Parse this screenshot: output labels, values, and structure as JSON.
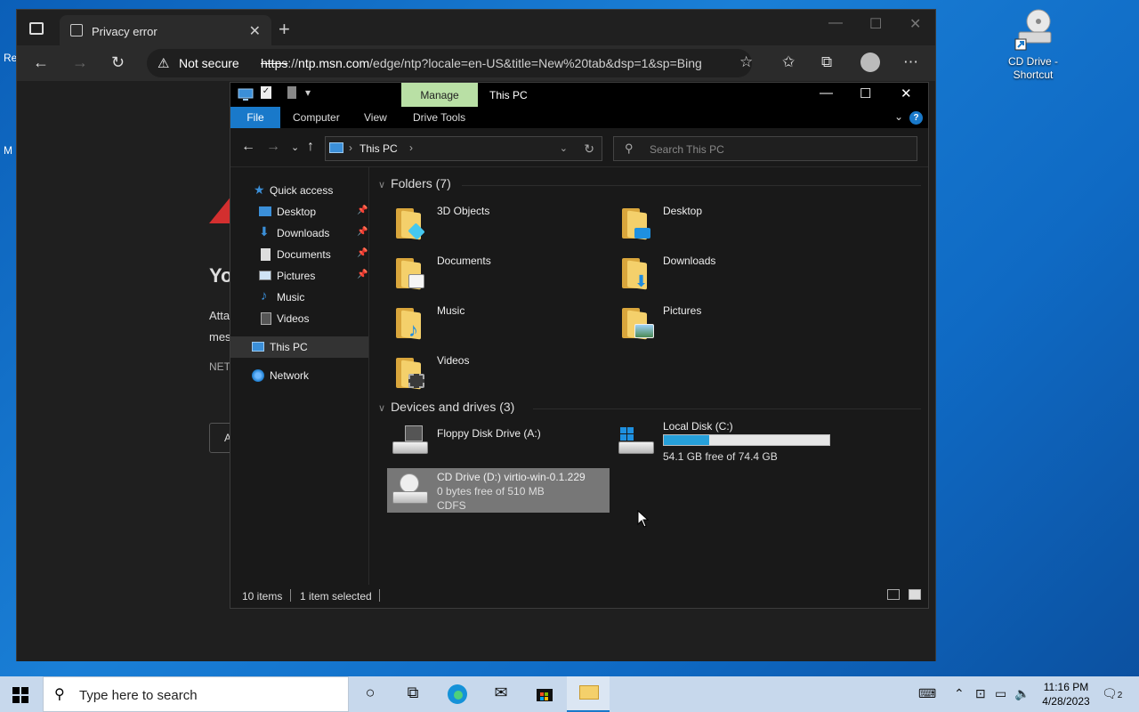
{
  "desktop": {
    "partial_labels": [
      "Re",
      "M"
    ],
    "icon": {
      "label": "CD Drive - Shortcut"
    }
  },
  "browser": {
    "tab_title": "Privacy error",
    "tab_close": "✕",
    "new_tab": "+",
    "address": {
      "security_text": "Not secure",
      "url_scheme": "https",
      "url_host": "ntp.msn.com",
      "url_path": "/edge/ntp?locale=en-US&title=New%20tab&dsp=1&sp=Bing"
    },
    "page_fragments": {
      "heading": "Yo",
      "line1": "Atta",
      "line2": "mes",
      "code": "NET",
      "button": "A"
    }
  },
  "explorer": {
    "quick_access_toolbar": [
      "✓",
      "▾"
    ],
    "context_tab": "Manage",
    "window_title": "This PC",
    "ribbon_tabs": [
      "File",
      "Computer",
      "View",
      "Drive Tools"
    ],
    "breadcrumb": "This PC",
    "search_placeholder": "Search This PC",
    "nav": {
      "quick_access": "Quick access",
      "items": [
        {
          "label": "Desktop",
          "pinned": true
        },
        {
          "label": "Downloads",
          "pinned": true
        },
        {
          "label": "Documents",
          "pinned": true
        },
        {
          "label": "Pictures",
          "pinned": true
        },
        {
          "label": "Music",
          "pinned": false
        },
        {
          "label": "Videos",
          "pinned": false
        }
      ],
      "this_pc": "This PC",
      "network": "Network"
    },
    "folders_header": "Folders (7)",
    "folders": [
      "3D Objects",
      "Desktop",
      "Documents",
      "Downloads",
      "Music",
      "Pictures",
      "Videos"
    ],
    "devices_header": "Devices and drives (3)",
    "drives": {
      "floppy": {
        "name": "Floppy Disk Drive (A:)"
      },
      "local": {
        "name": "Local Disk (C:)",
        "free_text": "54.1 GB free of 74.4 GB",
        "used_fraction": 0.273
      },
      "cd": {
        "name": "CD Drive (D:) virtio-win-0.1.229",
        "free_text": "0 bytes free of 510 MB",
        "fs": "CDFS"
      }
    },
    "status": {
      "items": "10 items",
      "selected": "1 item selected"
    }
  },
  "taskbar": {
    "search_placeholder": "Type here to search",
    "time": "11:16 PM",
    "date": "4/28/2023",
    "notification_count": "2"
  }
}
